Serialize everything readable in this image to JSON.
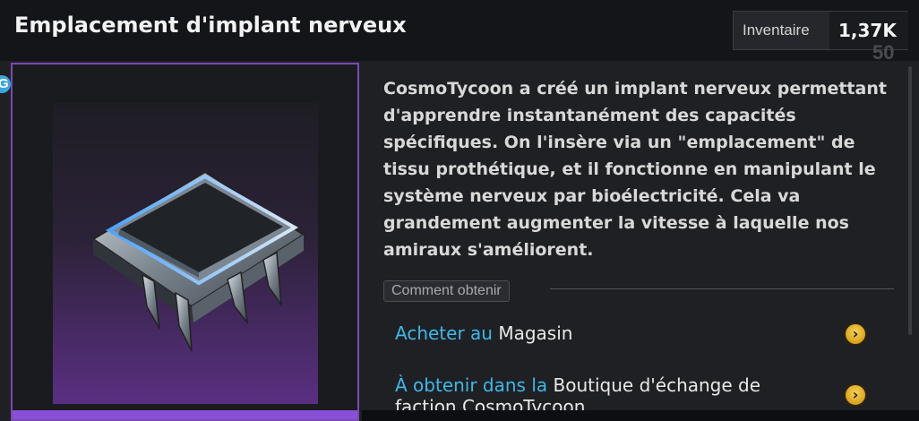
{
  "header": {
    "title": "Emplacement d'implant nerveux",
    "inventory_label": "Inventaire",
    "inventory_count": "1,37K",
    "ghost_number": "50"
  },
  "side_marker": {
    "letter": "G"
  },
  "item": {
    "icon": "neural-implant-chip-icon",
    "description": "CosmoTycoon a créé un implant nerveux permettant d'apprendre instantanément des capacités spécifiques. On l'insère via un \"emplacement\" de tissu prothétique, et il fonctionne en manipulant le système nerveux par bioélectricité. Cela va grandement augmenter la vitesse à laquelle nos amiraux s'améliorent."
  },
  "obtain": {
    "section_label": "Comment obtenir",
    "sources": [
      {
        "action": "Acheter au",
        "place": "Magasin"
      },
      {
        "action": "À obtenir dans la",
        "place": "Boutique d'échange de faction CosmoTycoon"
      }
    ]
  },
  "colors": {
    "accent_cyan": "#3fb8e8",
    "frame_purple": "#8a4fd8",
    "arrow_gold": "#e4b02a"
  }
}
